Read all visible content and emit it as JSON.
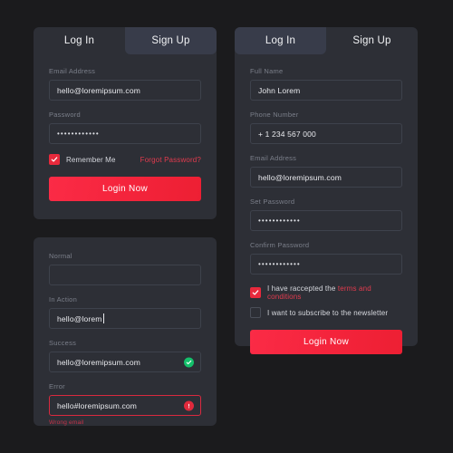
{
  "theme": {
    "page_bg": "#1b1b1d",
    "card_bg": "#2d2f36",
    "tab_active_bg": "#383c4a",
    "accent_red": "#f5253d",
    "success_green": "#14c06b",
    "error_red": "#e02a3c",
    "label_gray": "#7b7f8a"
  },
  "login_card": {
    "tabs": [
      {
        "label": "Log In",
        "active": false
      },
      {
        "label": "Sign Up",
        "active": true
      }
    ],
    "fields": [
      {
        "label": "Email Address",
        "value": "hello@loremipsum.com",
        "type": "text"
      },
      {
        "label": "Password",
        "value": "••••••••••••",
        "type": "password"
      }
    ],
    "remember_me": {
      "label": "Remember Me",
      "checked": true
    },
    "forgot_password": "Forgot Password?",
    "submit": "Login Now"
  },
  "states_card": {
    "fields": [
      {
        "label": "Normal",
        "value": "",
        "state": "normal"
      },
      {
        "label": "In Action",
        "value": "hello@lorem",
        "state": "focus"
      },
      {
        "label": "Success",
        "value": "hello@loremipsum.com",
        "state": "success"
      },
      {
        "label": "Error",
        "value": "hello#loremipsum.com",
        "state": "error"
      }
    ],
    "error_message": "Wrong email"
  },
  "signup_card": {
    "tabs": [
      {
        "label": "Log In",
        "active": true
      },
      {
        "label": "Sign Up",
        "active": false
      }
    ],
    "fields": [
      {
        "label": "Full Name",
        "value": "John Lorem",
        "type": "text"
      },
      {
        "label": "Phone Number",
        "value": "+ 1 234 567 000",
        "type": "text"
      },
      {
        "label": "Email Address",
        "value": "hello@loremipsum.com",
        "type": "text"
      },
      {
        "label": "Set Password",
        "value": "••••••••••••",
        "type": "password"
      },
      {
        "label": "Confirm Password",
        "value": "••••••••••••",
        "type": "password"
      }
    ],
    "terms": {
      "text_before": "I have raccepted the ",
      "link_text": "terms and conditions",
      "checked": true
    },
    "newsletter": {
      "label": "I want to subscribe to the newsletter",
      "checked": false
    },
    "submit": "Login Now"
  }
}
